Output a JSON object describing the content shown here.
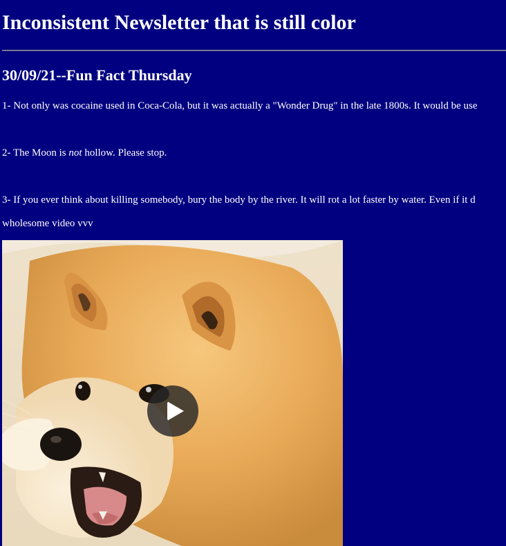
{
  "newsletter": {
    "title": "Inconsistent Newsletter that is still color",
    "entry": {
      "heading": "30/09/21--Fun Fact Thursday",
      "facts": [
        {
          "text": "1- Not only was cocaine used in Coca-Cola, but it was actually a \"Wonder Drug\" in the late 1800s. It would be use"
        },
        {
          "before": "2- The Moon is ",
          "emphasis": "not",
          "after": " hollow. Please stop."
        },
        {
          "text": "3- If you ever think about killing somebody, bury the body by the river. It will rot a lot faster by water. Even if it d"
        }
      ],
      "video_caption": "wholesome video vvv"
    }
  },
  "video": {
    "subject": "shiba inu dog",
    "play_icon": "play-icon"
  },
  "colors": {
    "background": "#000080",
    "text": "#ffffff"
  }
}
